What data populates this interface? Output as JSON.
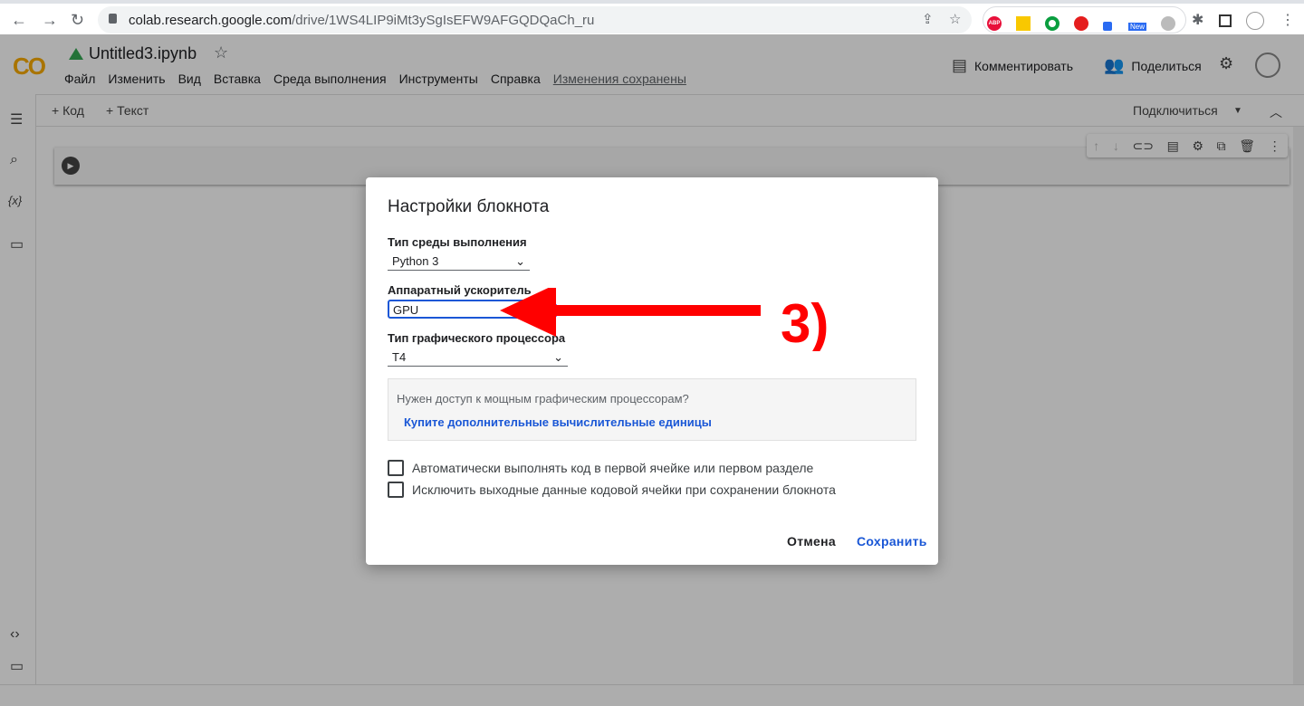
{
  "browser": {
    "url_host": "colab.research.google.com",
    "url_path": "/drive/1WS4LIP9iMt3ySgIsEFW9AFGQDQaCh_ru",
    "ext_badge": "New",
    "abp": "ABP"
  },
  "colab": {
    "logo": "CO",
    "title": "Untitled3.ipynb",
    "menu": [
      "Файл",
      "Изменить",
      "Вид",
      "Вставка",
      "Среда выполнения",
      "Инструменты",
      "Справка"
    ],
    "saved": "Изменения сохранены",
    "comment": "Комментировать",
    "share": "Поделиться",
    "add_code": "+ Код",
    "add_text": "+ Текст",
    "connect": "Подключиться",
    "vars_icon": "{x}"
  },
  "dialog": {
    "title": "Настройки блокнота",
    "runtime_label": "Тип среды выполнения",
    "runtime_value": "Python 3",
    "accel_label": "Аппаратный ускоритель",
    "accel_value": "GPU",
    "gpu_label": "Тип графического процессора",
    "gpu_value": "T4",
    "info_q": "Нужен доступ к мощным графическим процессорам?",
    "info_link": "Купите дополнительные вычислительные единицы",
    "check1": "Автоматически выполнять код в первой ячейке или первом разделе",
    "check2": "Исключить выходные данные кодовой ячейки при сохранении блокнота",
    "cancel": "Отмена",
    "save": "Сохранить"
  },
  "annotation": {
    "text": "3)",
    "color": "#ff0000"
  }
}
